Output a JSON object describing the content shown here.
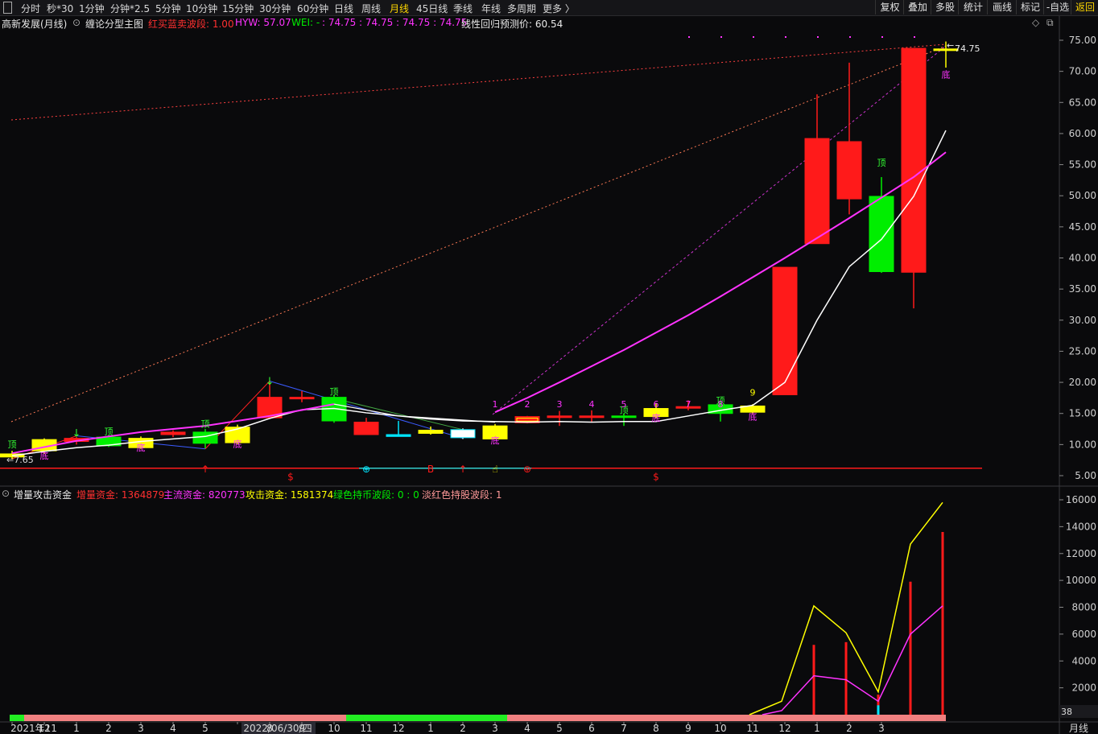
{
  "toolbar": {
    "periods": [
      "分时",
      "秒*30",
      "1分钟",
      "分钟*2.5",
      "5分钟",
      "10分钟",
      "15分钟",
      "30分钟",
      "60分钟",
      "日线",
      "周线",
      "月线",
      "45日线",
      "季线",
      "年线",
      "多周期",
      "更多 〉"
    ],
    "active_period": "月线",
    "right_buttons": [
      "复权",
      "叠加",
      "多股",
      "统计",
      "画线",
      "标记",
      "-自选",
      "返回"
    ],
    "active_right": "返回"
  },
  "main_header": {
    "stock": "高新发展(月线)",
    "indicator": "缠论分型主图",
    "red_blue_label": "红买蓝卖波段: 1.00",
    "hyw_label": "HYW: 57.07",
    "wei_label": "WEI: -",
    "values_text": ": 74.75 : 74.75 : 74.75 : 74.75",
    "regression_label": "线性回归预测价: 60.54"
  },
  "sub_header": {
    "indicator": "增量攻击资金",
    "incr_label": "增量资金: 1364879",
    "main_label": "主流资金: 820773",
    "attack_label": "攻击资金: 1581374",
    "green_label": "绿色持币波段: 0 : 0",
    "pink_label": "淡红色持股波段: 1"
  },
  "colors": {
    "up": "#ff1a1a",
    "down": "#00ee00",
    "yellow": "#ffff00",
    "magenta": "#ff33ff",
    "white": "#ffffff",
    "cyan": "#00e5ff",
    "blue": "#3b5bff",
    "axis_text": "#cfcfcf"
  },
  "chart_data": [
    {
      "type": "candlestick",
      "title": "高新发展(月线)",
      "ylim": [
        4,
        76
      ],
      "yticks": [
        "5.00",
        "10.00",
        "15.00",
        "20.00",
        "25.00",
        "30.00",
        "35.00",
        "40.00",
        "45.00",
        "50.00",
        "55.00",
        "60.00",
        "65.00",
        "70.00",
        "75.00"
      ],
      "ytick_values": [
        5,
        10,
        15,
        20,
        25,
        30,
        35,
        40,
        45,
        50,
        55,
        60,
        65,
        70,
        75
      ],
      "x": [
        "2021年11",
        "12",
        "1",
        "2",
        "3",
        "4",
        "5",
        "2022/06/30/四",
        "8",
        "9",
        "10",
        "11",
        "12",
        "1",
        "2",
        "3",
        "4",
        "5",
        "6",
        "7",
        "8",
        "9",
        "10",
        "11",
        "12",
        "1",
        "2",
        "3"
      ],
      "candles": [
        {
          "o": 8.0,
          "h": 9.0,
          "l": 7.65,
          "c": 8.5,
          "color": "yellow"
        },
        {
          "o": 9.0,
          "h": 11.0,
          "l": 8.5,
          "c": 10.8,
          "color": "yellow"
        },
        {
          "o": 10.5,
          "h": 11.2,
          "l": 10.0,
          "c": 11.0,
          "color": "red"
        },
        {
          "o": 11.2,
          "h": 11.4,
          "l": 9.6,
          "c": 9.8,
          "color": "green"
        },
        {
          "o": 9.5,
          "h": 11.3,
          "l": 9.3,
          "c": 11.0,
          "color": "yellow"
        },
        {
          "o": 11.6,
          "h": 12.3,
          "l": 11.2,
          "c": 12.0,
          "color": "red"
        },
        {
          "o": 12.0,
          "h": 12.5,
          "l": 9.4,
          "c": 10.2,
          "color": "green"
        },
        {
          "o": 10.3,
          "h": 13.2,
          "l": 10.1,
          "c": 12.8,
          "color": "yellow"
        },
        {
          "o": 14.3,
          "h": 20.2,
          "l": 14.3,
          "c": 17.6,
          "color": "red"
        },
        {
          "o": 17.4,
          "h": 18.6,
          "l": 16.8,
          "c": 17.6,
          "color": "redcross"
        },
        {
          "o": 17.6,
          "h": 18.0,
          "l": 13.5,
          "c": 13.8,
          "color": "green"
        },
        {
          "o": 11.6,
          "h": 14.3,
          "l": 11.6,
          "c": 13.6,
          "color": "red"
        },
        {
          "o": 11.3,
          "h": 13.8,
          "l": 11.3,
          "c": 11.6,
          "color": "cyan"
        },
        {
          "o": 11.8,
          "h": 12.9,
          "l": 11.6,
          "c": 12.3,
          "color": "yellow"
        },
        {
          "o": 11.1,
          "h": 12.6,
          "l": 10.9,
          "c": 12.4,
          "color": "whitecyan"
        },
        {
          "o": 10.9,
          "h": 13.3,
          "l": 10.9,
          "c": 13.0,
          "color": "yellow"
        },
        {
          "o": 13.5,
          "h": 14.6,
          "l": 13.4,
          "c": 14.5,
          "color": "redyellow"
        },
        {
          "o": 14.5,
          "h": 15.4,
          "l": 13.0,
          "c": 14.6,
          "color": "redcross"
        },
        {
          "o": 14.5,
          "h": 15.5,
          "l": 13.6,
          "c": 14.6,
          "color": "redcross"
        },
        {
          "o": 14.6,
          "h": 15.0,
          "l": 13.0,
          "c": 14.4,
          "color": "green"
        },
        {
          "o": 14.5,
          "h": 16.6,
          "l": 14.2,
          "c": 15.8,
          "color": "yellow"
        },
        {
          "o": 15.9,
          "h": 17.1,
          "l": 15.5,
          "c": 16.1,
          "color": "redcross"
        },
        {
          "o": 16.4,
          "h": 17.0,
          "l": 13.7,
          "c": 15.0,
          "color": "green"
        },
        {
          "o": 15.2,
          "h": 16.5,
          "l": 14.9,
          "c": 16.2,
          "color": "yellow"
        },
        {
          "o": 18.0,
          "h": 38.5,
          "l": 18.0,
          "c": 38.5,
          "color": "red"
        },
        {
          "o": 42.3,
          "h": 66.3,
          "l": 42.3,
          "c": 59.2,
          "color": "red"
        },
        {
          "o": 49.5,
          "h": 71.4,
          "l": 47.0,
          "c": 58.7,
          "color": "red"
        },
        {
          "o": 49.9,
          "h": 53.0,
          "l": 37.6,
          "c": 37.8,
          "color": "green"
        },
        {
          "o": 37.7,
          "h": 73.7,
          "l": 31.9,
          "c": 73.7,
          "color": "red"
        },
        {
          "o": 73.4,
          "h": 74.8,
          "l": 70.6,
          "c": 73.6,
          "color": "yellowcross"
        }
      ],
      "ma_white": [
        8.2,
        8.9,
        9.5,
        9.9,
        10.5,
        10.9,
        11.3,
        12.5,
        14.2,
        15.6,
        15.8,
        15.1,
        14.6,
        14.1,
        13.8,
        13.7,
        13.6,
        13.7,
        13.6,
        13.7,
        13.7,
        14.6,
        15.5,
        16.3,
        20.0,
        30.0,
        38.6,
        43.0,
        49.9,
        60.5
      ],
      "ma_magenta": [
        null,
        null,
        null,
        null,
        null,
        null,
        null,
        null,
        null,
        null,
        null,
        null,
        null,
        null,
        null,
        null,
        15.2,
        17.5,
        20.0,
        22.6,
        25.2,
        28.0,
        30.8,
        33.8,
        36.9,
        40.0,
        43.2,
        46.4,
        49.7,
        53.0,
        57.0
      ],
      "annotations": {
        "price_label": "74.75",
        "low_label": "7.65",
        "top_char": "顶",
        "bottom_char": "底",
        "counts": [
          "1",
          "2",
          "3",
          "4",
          "5",
          "6",
          "7",
          "8",
          "9"
        ],
        "ref_line_value": 6.2
      }
    },
    {
      "type": "line",
      "title": "增量攻击资金",
      "ylim": [
        0,
        16800
      ],
      "yticks": [
        "2000",
        "4000",
        "6000",
        "8000",
        "10000",
        "12000",
        "14000",
        "16000"
      ],
      "ytick_values": [
        2000,
        4000,
        6000,
        8000,
        10000,
        12000,
        14000,
        16000
      ],
      "corner_value": "38",
      "series": [
        {
          "name": "攻击资金",
          "color": "yellow",
          "points": [
            [
              23,
              0
            ],
            [
              24,
              1000
            ],
            [
              25,
              8100
            ],
            [
              26,
              6100
            ],
            [
              27,
              1700
            ],
            [
              28,
              12700
            ],
            [
              29,
              15800
            ]
          ]
        },
        {
          "name": "主流资金",
          "color": "magenta",
          "points": [
            [
              23.4,
              0
            ],
            [
              24,
              300
            ],
            [
              25,
              2900
            ],
            [
              26,
              2600
            ],
            [
              27,
              1000
            ],
            [
              28,
              6000
            ],
            [
              29,
              8100
            ]
          ]
        }
      ],
      "bars": [
        [
          25,
          5200
        ],
        [
          26,
          5400
        ],
        [
          27,
          1500
        ],
        [
          28,
          9900
        ],
        [
          29,
          13600
        ]
      ],
      "band": [
        {
          "from": -1,
          "to": 0,
          "color": "green"
        },
        {
          "from": 0,
          "to": 10,
          "color": "pink"
        },
        {
          "from": 10,
          "to": 15,
          "color": "green"
        },
        {
          "from": 15,
          "to": 29,
          "color": "pink"
        }
      ],
      "period_label": "月线"
    }
  ]
}
